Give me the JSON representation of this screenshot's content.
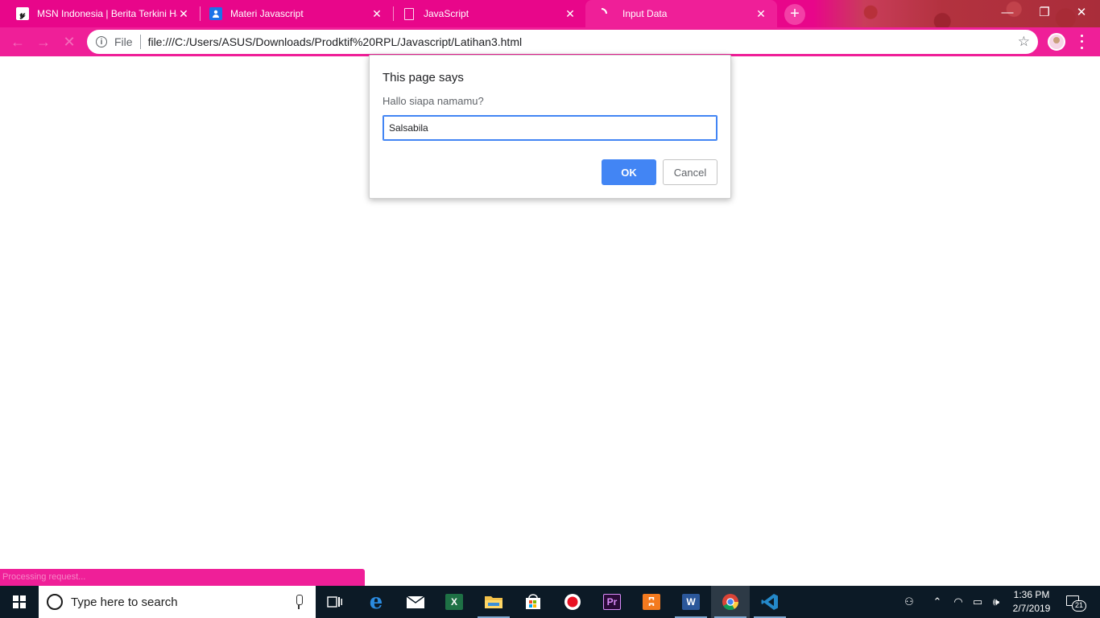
{
  "browser": {
    "tabs": [
      {
        "title": "MSN Indonesia | Berita Terkini Ha",
        "favicon": "msn-icon",
        "active": false
      },
      {
        "title": "Materi Javascript",
        "favicon": "classroom-icon",
        "active": false
      },
      {
        "title": "JavaScript",
        "favicon": "document-icon",
        "active": false
      },
      {
        "title": "Input Data",
        "favicon": "loading-icon",
        "active": true
      }
    ],
    "close_glyph": "✕",
    "new_tab_glyph": "+",
    "window_controls": {
      "minimize": "—",
      "restore": "❐",
      "close": "✕"
    },
    "toolbar": {
      "back_glyph": "←",
      "forward_glyph": "→",
      "stop_glyph": "✕",
      "scheme_label": "File",
      "url": "file:///C:/Users/ASUS/Downloads/Prodktif%20RPL/Javascript/Latihan3.html",
      "bookmark_glyph": "☆"
    },
    "status_text": "Processing request...",
    "accent_color": "#e8068a"
  },
  "dialog": {
    "title": "This page says",
    "message": "Hallo siapa namamu?",
    "input_value": "Salsabila",
    "ok_label": "OK",
    "cancel_label": "Cancel"
  },
  "taskbar": {
    "search_placeholder": "Type here to search",
    "apps": [
      {
        "name": "task-view-icon",
        "glyph": "⧉"
      },
      {
        "name": "edge-icon",
        "glyph": "e",
        "color": "#1e90e6"
      },
      {
        "name": "mail-icon",
        "glyph": "✉"
      },
      {
        "name": "excel-icon",
        "glyph": "X",
        "color": "#1e7145"
      },
      {
        "name": "file-explorer-icon",
        "glyph": "▬",
        "color": "#f3c14a"
      },
      {
        "name": "store-icon",
        "glyph": "▦"
      },
      {
        "name": "recorder-icon",
        "glyph": "●",
        "color": "#e81123"
      },
      {
        "name": "premiere-icon",
        "glyph": "Pr",
        "color": "#2a0a38"
      },
      {
        "name": "xampp-icon",
        "glyph": "⊠",
        "color": "#f37a1f"
      },
      {
        "name": "word-icon",
        "glyph": "W",
        "color": "#2b579a"
      },
      {
        "name": "chrome-icon",
        "glyph": "◉"
      },
      {
        "name": "vscode-icon",
        "glyph": "⋈",
        "color": "#2489ca"
      }
    ],
    "tray": {
      "people_glyph": "⚇",
      "chevron_glyph": "⌃",
      "wifi_glyph": "◠",
      "battery_glyph": "▭",
      "volume_glyph": "🕪"
    },
    "clock_time": "1:36 PM",
    "clock_date": "2/7/2019",
    "notification_count": "21"
  }
}
